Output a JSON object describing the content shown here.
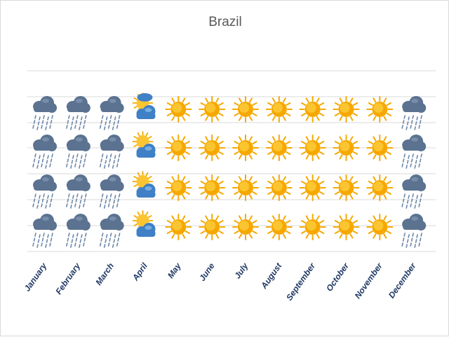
{
  "chart_data": {
    "type": "pictograph",
    "title": "Brazil",
    "xlabel": "",
    "ylabel": "",
    "categories": [
      "January",
      "February",
      "March",
      "April",
      "May",
      "June",
      "July",
      "August",
      "September",
      "October",
      "November",
      "December"
    ],
    "values": [
      "rain",
      "rain",
      "rain",
      "partly-cloudy",
      "sun",
      "sun",
      "sun",
      "sun",
      "sun",
      "sun",
      "sun",
      "rain"
    ],
    "icons_per_category": 4,
    "grid": true,
    "legend": "none"
  },
  "icons": {
    "rain": "rain-cloud-icon",
    "partly-cloudy": "sun-behind-cloud-icon",
    "sun": "sun-icon"
  },
  "colors": {
    "cloud": "#5b7290",
    "rain": "#6f89a9",
    "sun": "#f6a800",
    "sun_core": "#fbc531",
    "blue_cloud": "#3f80c6",
    "grid": "#d9d9d9",
    "label": "#1f3864"
  }
}
